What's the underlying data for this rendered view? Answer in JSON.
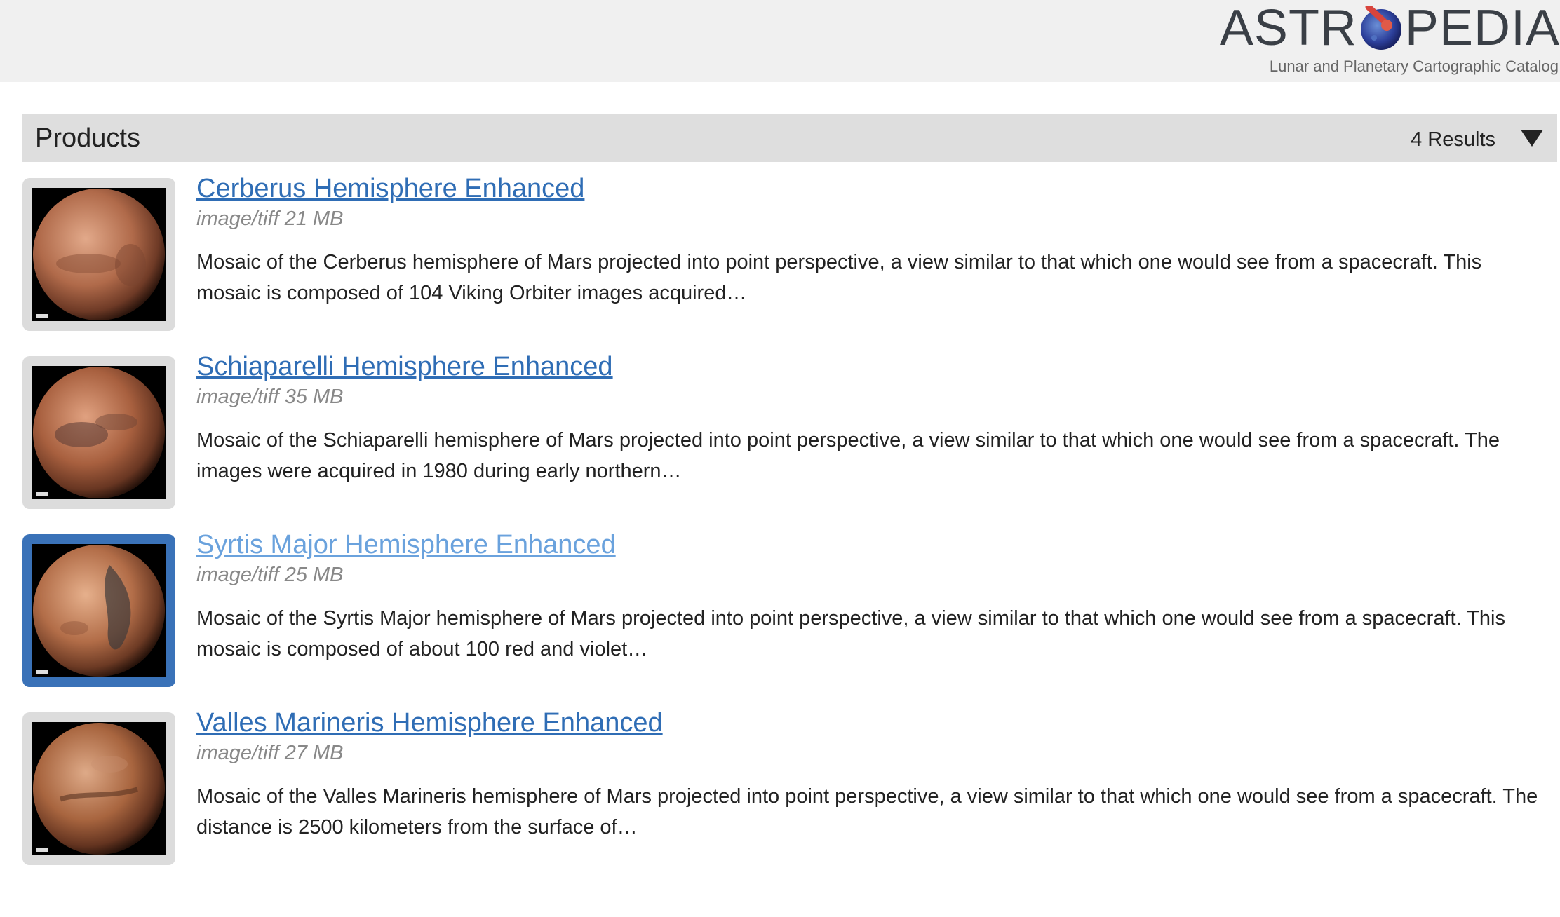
{
  "brand": {
    "name_left": "ASTR",
    "name_right": "PEDIA",
    "tagline": "Lunar and Planetary Cartographic Catalog"
  },
  "products": {
    "title": "Products",
    "results": "4 Results"
  },
  "items": [
    {
      "title": "Cerberus Hemisphere Enhanced",
      "meta": "image/tiff 21 MB",
      "description": "Mosaic of the Cerberus hemisphere of Mars projected into point perspective, a view similar to that which one would see from a spacecraft. This mosaic is composed of 104 Viking Orbiter images acquired…"
    },
    {
      "title": "Schiaparelli Hemisphere Enhanced",
      "meta": "image/tiff 35 MB",
      "description": "Mosaic of the Schiaparelli hemisphere of Mars projected into point perspective, a view similar to that which one would see from a spacecraft. The images were acquired in 1980 during early northern…"
    },
    {
      "title": "Syrtis Major Hemisphere Enhanced",
      "meta": "image/tiff 25 MB",
      "description": "Mosaic of the Syrtis Major hemisphere of Mars projected into point perspective, a view similar to that which one would see from a spacecraft. This mosaic is composed of about 100 red and violet…"
    },
    {
      "title": "Valles Marineris Hemisphere Enhanced",
      "meta": "image/tiff 27 MB",
      "description": "Mosaic of the Valles Marineris hemisphere of Mars projected into point perspective, a view similar to that which one would see from a spacecraft. The distance is 2500 kilometers from the surface of…"
    }
  ],
  "colors": {
    "link": "#2f6db5",
    "link_visited": "#6aa2dd",
    "selected_thumb": "#3a72b8",
    "header_bg": "#f0f0f0",
    "bar_bg": "#dedede"
  },
  "icons": {
    "results_toggle": "triangle-down-icon",
    "logo_o": "planet-meteor-icon"
  }
}
